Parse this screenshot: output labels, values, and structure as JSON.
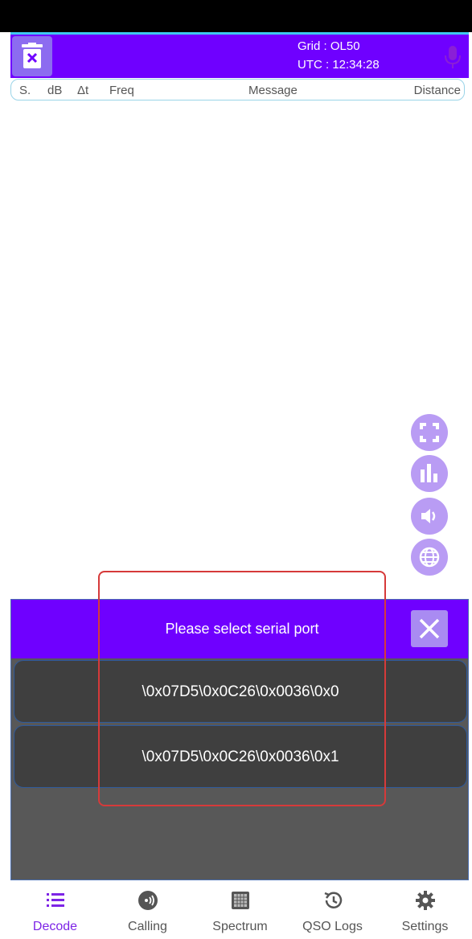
{
  "header": {
    "grid": "Grid : OL50",
    "utc": "UTC : 12:34:28"
  },
  "columns": {
    "s": "S.",
    "db": "dB",
    "dt": "Δt",
    "freq": "Freq",
    "message": "Message",
    "distance": "Distance"
  },
  "dialog": {
    "title": "Please select serial port",
    "ports": [
      "\\0x07D5\\0x0C26\\0x0036\\0x0",
      "\\0x07D5\\0x0C26\\0x0036\\0x1"
    ]
  },
  "nav": {
    "items": [
      {
        "label": "Decode",
        "icon": "list-icon",
        "active": true
      },
      {
        "label": "Calling",
        "icon": "broadcast-icon",
        "active": false
      },
      {
        "label": "Spectrum",
        "icon": "waterfall-icon",
        "active": false
      },
      {
        "label": "QSO Logs",
        "icon": "history-icon",
        "active": false
      },
      {
        "label": "Settings",
        "icon": "gear-icon",
        "active": false
      }
    ]
  },
  "colors": {
    "accent": "#6f00ff",
    "active_nav": "#7d24e6",
    "fab": "#b99cf4",
    "highlight": "#d63a3a"
  }
}
